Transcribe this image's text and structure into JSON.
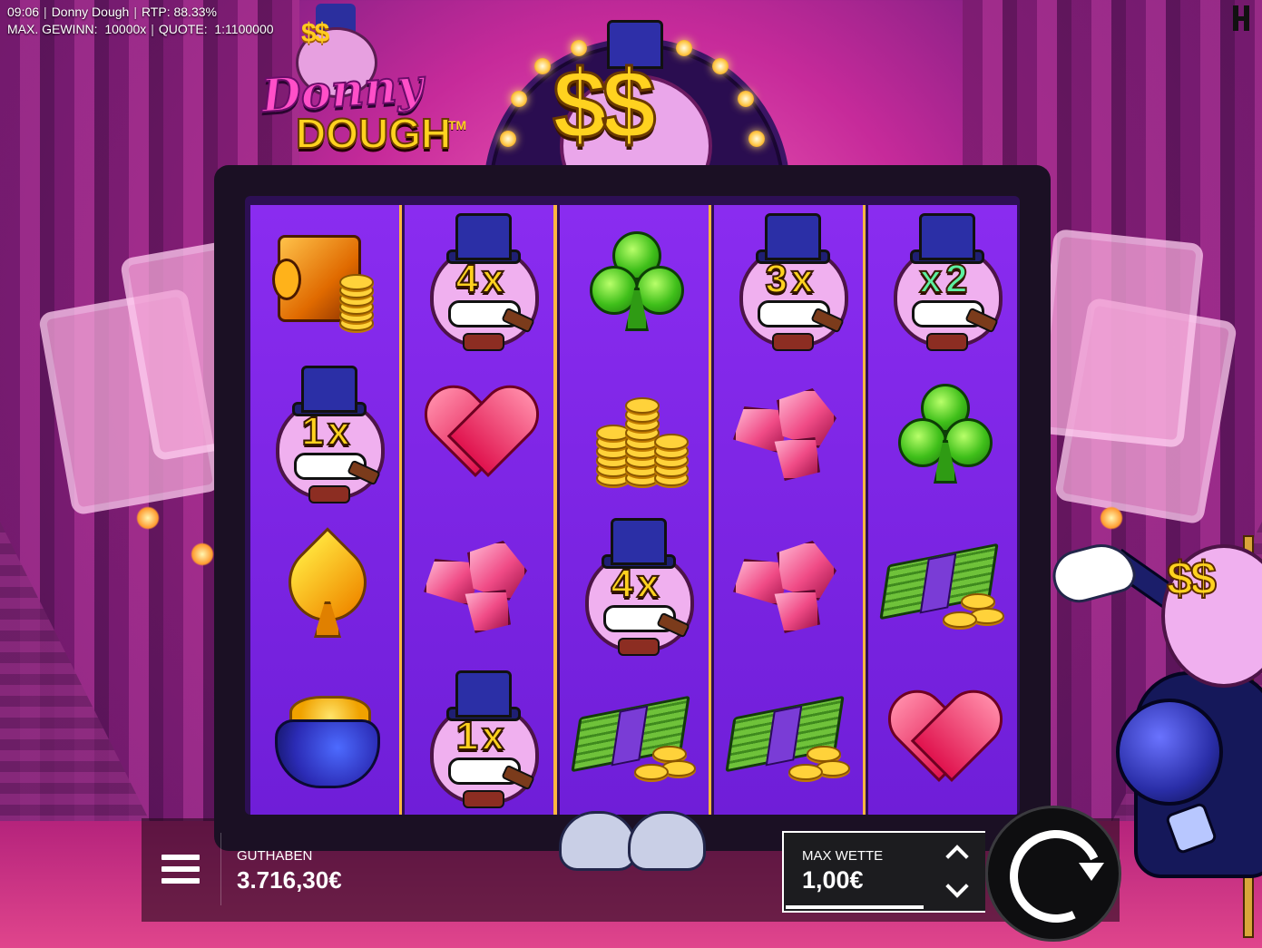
{
  "status_bar": {
    "time": "09:06",
    "game_name": "Donny Dough",
    "rtp_label": "RTP:",
    "rtp_value": "88.33%",
    "max_win_label": "MAX. GEWINN:",
    "max_win_value": "10000x",
    "odds_label": "QUOTE:",
    "odds_value": "1:1100000"
  },
  "logo": {
    "line1": "Donny",
    "line2": "DOUGH",
    "trademark": "TM",
    "eyes": "$$"
  },
  "marquee": {
    "eyes": "$$"
  },
  "reels": [
    {
      "symbols": [
        {
          "type": "safe",
          "icon": "safe-icon"
        },
        {
          "type": "donny",
          "multiplier": "1x",
          "mult_color": "#ffd21f"
        },
        {
          "type": "spade",
          "icon": "spade-icon"
        },
        {
          "type": "purse",
          "icon": "coin-purse-icon"
        }
      ]
    },
    {
      "symbols": [
        {
          "type": "donny",
          "multiplier": "4x",
          "mult_color": "#ffd21f"
        },
        {
          "type": "heart",
          "icon": "heart-icon"
        },
        {
          "type": "gems",
          "icon": "gems-icon"
        },
        {
          "type": "donny",
          "multiplier": "1x",
          "mult_color": "#ffd21f"
        }
      ]
    },
    {
      "symbols": [
        {
          "type": "clubs",
          "icon": "club-icon"
        },
        {
          "type": "coins",
          "icon": "coin-stack-icon"
        },
        {
          "type": "donny",
          "multiplier": "4x",
          "mult_color": "#ffd21f"
        },
        {
          "type": "cash",
          "icon": "cash-stack-icon"
        }
      ]
    },
    {
      "symbols": [
        {
          "type": "donny",
          "multiplier": "3x",
          "mult_color": "#ffd21f"
        },
        {
          "type": "gems",
          "icon": "gems-icon"
        },
        {
          "type": "gems",
          "icon": "gems-icon"
        },
        {
          "type": "cash",
          "icon": "cash-stack-icon"
        }
      ]
    },
    {
      "symbols": [
        {
          "type": "donny",
          "multiplier": "x2",
          "mult_color": "#5cf0a0"
        },
        {
          "type": "clubs",
          "icon": "club-icon"
        },
        {
          "type": "cash",
          "icon": "cash-stack-icon"
        },
        {
          "type": "heart",
          "icon": "heart-icon"
        }
      ]
    }
  ],
  "controls": {
    "menu_icon": "hamburger-menu-icon",
    "balance_label": "GUTHABEN",
    "balance_value": "3.716,30€",
    "bet_label": "MAX WETTE",
    "bet_value": "1,00€",
    "bet_up_icon": "chevron-up-icon",
    "bet_down_icon": "chevron-down-icon",
    "spin_icon": "spin-arrow-icon"
  },
  "mascot": {
    "eyes": "$$"
  },
  "colors": {
    "reel_bg": "#7a24e4",
    "reel_divider": "#ffb640",
    "gold": "#ffd21f",
    "logo_pink": "#ff4fc8"
  }
}
